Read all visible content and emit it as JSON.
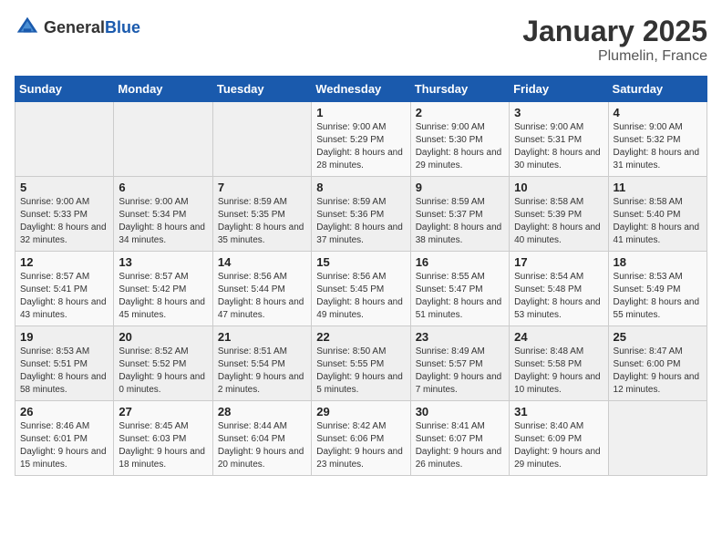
{
  "header": {
    "logo_general": "General",
    "logo_blue": "Blue",
    "title": "January 2025",
    "subtitle": "Plumelin, France"
  },
  "days_of_week": [
    "Sunday",
    "Monday",
    "Tuesday",
    "Wednesday",
    "Thursday",
    "Friday",
    "Saturday"
  ],
  "weeks": [
    [
      {
        "day": "",
        "sunrise": "",
        "sunset": "",
        "daylight": ""
      },
      {
        "day": "",
        "sunrise": "",
        "sunset": "",
        "daylight": ""
      },
      {
        "day": "",
        "sunrise": "",
        "sunset": "",
        "daylight": ""
      },
      {
        "day": "1",
        "sunrise": "Sunrise: 9:00 AM",
        "sunset": "Sunset: 5:29 PM",
        "daylight": "Daylight: 8 hours and 28 minutes."
      },
      {
        "day": "2",
        "sunrise": "Sunrise: 9:00 AM",
        "sunset": "Sunset: 5:30 PM",
        "daylight": "Daylight: 8 hours and 29 minutes."
      },
      {
        "day": "3",
        "sunrise": "Sunrise: 9:00 AM",
        "sunset": "Sunset: 5:31 PM",
        "daylight": "Daylight: 8 hours and 30 minutes."
      },
      {
        "day": "4",
        "sunrise": "Sunrise: 9:00 AM",
        "sunset": "Sunset: 5:32 PM",
        "daylight": "Daylight: 8 hours and 31 minutes."
      }
    ],
    [
      {
        "day": "5",
        "sunrise": "Sunrise: 9:00 AM",
        "sunset": "Sunset: 5:33 PM",
        "daylight": "Daylight: 8 hours and 32 minutes."
      },
      {
        "day": "6",
        "sunrise": "Sunrise: 9:00 AM",
        "sunset": "Sunset: 5:34 PM",
        "daylight": "Daylight: 8 hours and 34 minutes."
      },
      {
        "day": "7",
        "sunrise": "Sunrise: 8:59 AM",
        "sunset": "Sunset: 5:35 PM",
        "daylight": "Daylight: 8 hours and 35 minutes."
      },
      {
        "day": "8",
        "sunrise": "Sunrise: 8:59 AM",
        "sunset": "Sunset: 5:36 PM",
        "daylight": "Daylight: 8 hours and 37 minutes."
      },
      {
        "day": "9",
        "sunrise": "Sunrise: 8:59 AM",
        "sunset": "Sunset: 5:37 PM",
        "daylight": "Daylight: 8 hours and 38 minutes."
      },
      {
        "day": "10",
        "sunrise": "Sunrise: 8:58 AM",
        "sunset": "Sunset: 5:39 PM",
        "daylight": "Daylight: 8 hours and 40 minutes."
      },
      {
        "day": "11",
        "sunrise": "Sunrise: 8:58 AM",
        "sunset": "Sunset: 5:40 PM",
        "daylight": "Daylight: 8 hours and 41 minutes."
      }
    ],
    [
      {
        "day": "12",
        "sunrise": "Sunrise: 8:57 AM",
        "sunset": "Sunset: 5:41 PM",
        "daylight": "Daylight: 8 hours and 43 minutes."
      },
      {
        "day": "13",
        "sunrise": "Sunrise: 8:57 AM",
        "sunset": "Sunset: 5:42 PM",
        "daylight": "Daylight: 8 hours and 45 minutes."
      },
      {
        "day": "14",
        "sunrise": "Sunrise: 8:56 AM",
        "sunset": "Sunset: 5:44 PM",
        "daylight": "Daylight: 8 hours and 47 minutes."
      },
      {
        "day": "15",
        "sunrise": "Sunrise: 8:56 AM",
        "sunset": "Sunset: 5:45 PM",
        "daylight": "Daylight: 8 hours and 49 minutes."
      },
      {
        "day": "16",
        "sunrise": "Sunrise: 8:55 AM",
        "sunset": "Sunset: 5:47 PM",
        "daylight": "Daylight: 8 hours and 51 minutes."
      },
      {
        "day": "17",
        "sunrise": "Sunrise: 8:54 AM",
        "sunset": "Sunset: 5:48 PM",
        "daylight": "Daylight: 8 hours and 53 minutes."
      },
      {
        "day": "18",
        "sunrise": "Sunrise: 8:53 AM",
        "sunset": "Sunset: 5:49 PM",
        "daylight": "Daylight: 8 hours and 55 minutes."
      }
    ],
    [
      {
        "day": "19",
        "sunrise": "Sunrise: 8:53 AM",
        "sunset": "Sunset: 5:51 PM",
        "daylight": "Daylight: 8 hours and 58 minutes."
      },
      {
        "day": "20",
        "sunrise": "Sunrise: 8:52 AM",
        "sunset": "Sunset: 5:52 PM",
        "daylight": "Daylight: 9 hours and 0 minutes."
      },
      {
        "day": "21",
        "sunrise": "Sunrise: 8:51 AM",
        "sunset": "Sunset: 5:54 PM",
        "daylight": "Daylight: 9 hours and 2 minutes."
      },
      {
        "day": "22",
        "sunrise": "Sunrise: 8:50 AM",
        "sunset": "Sunset: 5:55 PM",
        "daylight": "Daylight: 9 hours and 5 minutes."
      },
      {
        "day": "23",
        "sunrise": "Sunrise: 8:49 AM",
        "sunset": "Sunset: 5:57 PM",
        "daylight": "Daylight: 9 hours and 7 minutes."
      },
      {
        "day": "24",
        "sunrise": "Sunrise: 8:48 AM",
        "sunset": "Sunset: 5:58 PM",
        "daylight": "Daylight: 9 hours and 10 minutes."
      },
      {
        "day": "25",
        "sunrise": "Sunrise: 8:47 AM",
        "sunset": "Sunset: 6:00 PM",
        "daylight": "Daylight: 9 hours and 12 minutes."
      }
    ],
    [
      {
        "day": "26",
        "sunrise": "Sunrise: 8:46 AM",
        "sunset": "Sunset: 6:01 PM",
        "daylight": "Daylight: 9 hours and 15 minutes."
      },
      {
        "day": "27",
        "sunrise": "Sunrise: 8:45 AM",
        "sunset": "Sunset: 6:03 PM",
        "daylight": "Daylight: 9 hours and 18 minutes."
      },
      {
        "day": "28",
        "sunrise": "Sunrise: 8:44 AM",
        "sunset": "Sunset: 6:04 PM",
        "daylight": "Daylight: 9 hours and 20 minutes."
      },
      {
        "day": "29",
        "sunrise": "Sunrise: 8:42 AM",
        "sunset": "Sunset: 6:06 PM",
        "daylight": "Daylight: 9 hours and 23 minutes."
      },
      {
        "day": "30",
        "sunrise": "Sunrise: 8:41 AM",
        "sunset": "Sunset: 6:07 PM",
        "daylight": "Daylight: 9 hours and 26 minutes."
      },
      {
        "day": "31",
        "sunrise": "Sunrise: 8:40 AM",
        "sunset": "Sunset: 6:09 PM",
        "daylight": "Daylight: 9 hours and 29 minutes."
      },
      {
        "day": "",
        "sunrise": "",
        "sunset": "",
        "daylight": ""
      }
    ]
  ]
}
